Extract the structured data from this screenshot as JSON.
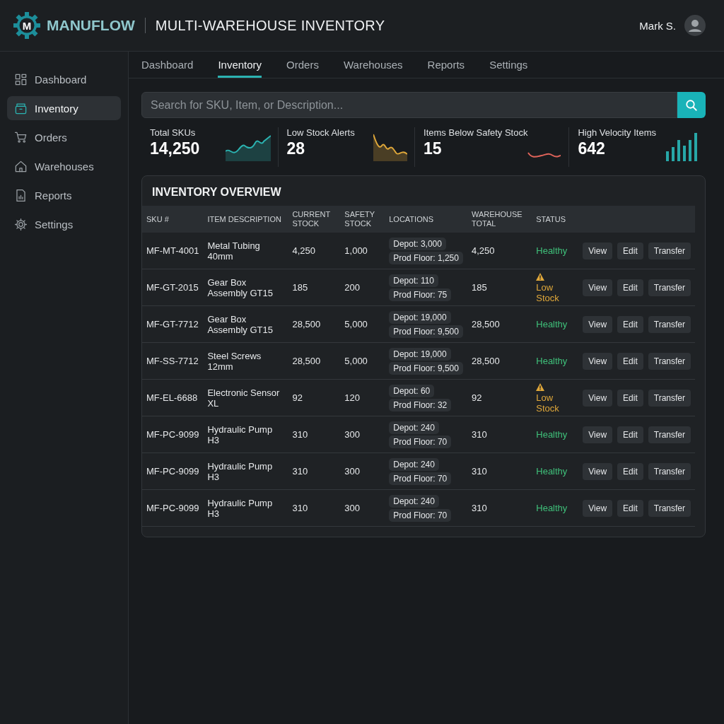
{
  "header": {
    "logo_letter": "M",
    "brand": "MANUFLOW",
    "title": "MULTI-WAREHOUSE INVENTORY",
    "user": "Mark S."
  },
  "sidebar": {
    "items": [
      {
        "label": "Dashboard",
        "selected": false
      },
      {
        "label": "Inventory",
        "selected": true
      },
      {
        "label": "Orders",
        "selected": false
      },
      {
        "label": "Warehouses",
        "selected": false
      },
      {
        "label": "Reports",
        "selected": false
      },
      {
        "label": "Settings",
        "selected": false
      }
    ]
  },
  "tabs": [
    {
      "label": "Dashboard",
      "selected": false
    },
    {
      "label": "Inventory",
      "selected": true
    },
    {
      "label": "Orders",
      "selected": false
    },
    {
      "label": "Warehouses",
      "selected": false
    },
    {
      "label": "Reports",
      "selected": false
    },
    {
      "label": "Settings",
      "selected": false
    }
  ],
  "search": {
    "placeholder": "Search for SKU, Item, or Description..."
  },
  "stats": [
    {
      "label": "Total SKUs",
      "value": "14,250",
      "kind": "area"
    },
    {
      "label": "Low Stock Alerts",
      "value": "28",
      "kind": "falling"
    },
    {
      "label": "Items Below Safety Stock",
      "value": "15",
      "kind": "flat"
    },
    {
      "label": "High Velocity Items",
      "value": "642",
      "kind": "bars"
    }
  ],
  "table": {
    "title": "INVENTORY OVERVIEW",
    "columns": [
      "SKU #",
      "ITEM DESCRIPTION",
      "CURRENT STOCK",
      "SAFETY STOCK",
      "LOCATIONS",
      "WAREHOUSE TOTAL",
      "STATUS"
    ],
    "rows": [
      {
        "sku": "MF-MT-4001",
        "description": "Metal Tubing 40mm",
        "current": "4,250",
        "safety": "1,000",
        "locations": [
          "Depot: 3,000",
          "Prod Floor: 1,250"
        ],
        "total": "4,250",
        "status": "Healthy",
        "kind": "healthy",
        "actions": [
          "View",
          "Edit",
          "Transfer"
        ]
      },
      {
        "sku": "MF-GT-2015",
        "description": "Gear Box Assembly GT15",
        "current": "185",
        "safety": "200",
        "locations": [
          "Depot: 110",
          "Prod Floor: 75"
        ],
        "total": "185",
        "status": "Low Stock",
        "kind": "low",
        "actions": [
          "View",
          "Edit",
          "Transfer"
        ]
      },
      {
        "sku": "MF-GT-7712",
        "description": "Gear Box Assembly GT15",
        "current": "28,500",
        "safety": "5,000",
        "locations": [
          "Depot: 19,000",
          "Prod Floor: 9,500"
        ],
        "total": "28,500",
        "status": "Healthy",
        "kind": "healthy",
        "actions": [
          "View",
          "Edit",
          "Transfer"
        ]
      },
      {
        "sku": "MF-SS-7712",
        "description": "Steel Screws 12mm",
        "current": "28,500",
        "safety": "5,000",
        "locations": [
          "Depot: 19,000",
          "Prod Floor: 9,500"
        ],
        "total": "28,500",
        "status": "Healthy",
        "kind": "healthy",
        "actions": [
          "View",
          "Edit",
          "Transfer"
        ]
      },
      {
        "sku": "MF-EL-6688",
        "description": "Electronic Sensor XL",
        "current": "92",
        "safety": "120",
        "locations": [
          "Depot: 60",
          "Prod Floor: 32"
        ],
        "total": "92",
        "status": "Low Stock",
        "kind": "low",
        "actions": [
          "View",
          "Edit",
          "Transfer"
        ]
      },
      {
        "sku": "MF-PC-9099",
        "description": "Hydraulic Pump H3",
        "current": "310",
        "safety": "300",
        "locations": [
          "Depot: 240",
          "Prod Floor: 70"
        ],
        "total": "310",
        "status": "Healthy",
        "kind": "healthy",
        "actions": [
          "View",
          "Edit",
          "Transfer"
        ]
      },
      {
        "sku": "MF-PC-9099",
        "description": "Hydraulic Pump H3",
        "current": "310",
        "safety": "300",
        "locations": [
          "Depot: 240",
          "Prod Floor: 70"
        ],
        "total": "310",
        "status": "Healthy",
        "kind": "healthy",
        "actions": [
          "View",
          "Edit",
          "Transfer"
        ]
      },
      {
        "sku": "MF-PC-9099",
        "description": "Hydraulic Pump H3",
        "current": "310",
        "safety": "300",
        "locations": [
          "Depot: 240",
          "Prod Floor: 70"
        ],
        "total": "310",
        "status": "Healthy",
        "kind": "healthy",
        "actions": [
          "View",
          "Edit",
          "Transfer"
        ]
      }
    ]
  }
}
